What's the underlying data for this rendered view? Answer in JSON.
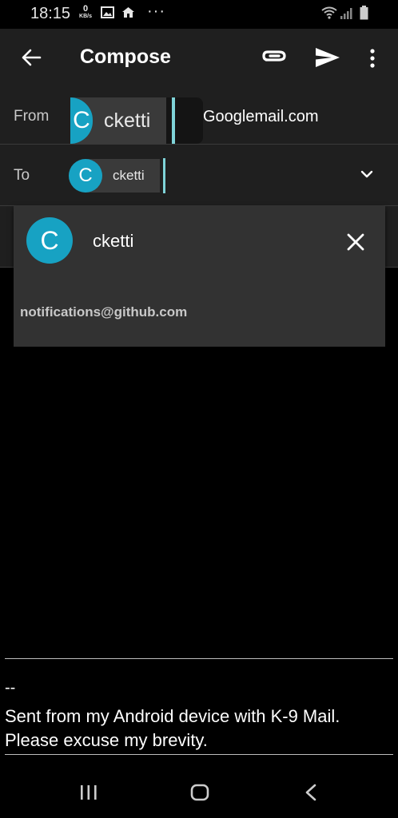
{
  "status_bar": {
    "time": "18:15",
    "speed_value": "0",
    "speed_unit": "KB/s",
    "more": "···",
    "icons": [
      "image-icon",
      "home-icon",
      "wifi-icon",
      "signal-icon",
      "battery-icon"
    ]
  },
  "app_bar": {
    "title": "Compose",
    "icons": [
      "back-arrow-icon",
      "attachment-icon",
      "send-icon",
      "overflow-menu-icon"
    ]
  },
  "from": {
    "label": "From",
    "avatar_letter": "C",
    "name": "cketti",
    "domain": "Googlemail.com"
  },
  "to": {
    "label": "To",
    "avatar_letter": "C",
    "name": "cketti",
    "expand_icon": "chevron-down-icon"
  },
  "recipient_popup": {
    "avatar_letter": "C",
    "name": "cketti",
    "email": "notifications@github.com",
    "close_icon": "close-icon"
  },
  "signature": {
    "separator": "--",
    "text": "Sent from my Android device with K-9 Mail.\nPlease excuse my brevity."
  },
  "nav_bar": {
    "icons": [
      "recent-apps-icon",
      "home-button-icon",
      "back-icon"
    ]
  },
  "colors": {
    "accent": "#17a2c3",
    "cursor": "#7fd3d8",
    "toolbar_bg": "#1f1f1f",
    "popup_bg": "#323232",
    "chip_bg": "#3a3a3a"
  }
}
